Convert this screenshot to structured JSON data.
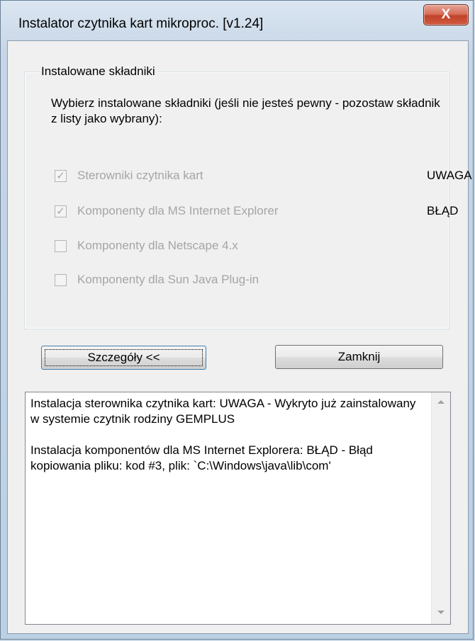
{
  "window": {
    "title": "Instalator czytnika kart mikroproc. [v1.24]",
    "close_glyph": "X"
  },
  "group": {
    "legend": "Instalowane składniki",
    "instruction": "Wybierz instalowane składniki (jeśli nie jesteś pewny - pozostaw składnik z listy jako wybrany):",
    "components": [
      {
        "label": "Sterowniki czytnika kart",
        "checked": true,
        "status": "UWAGA"
      },
      {
        "label": "Komponenty dla MS Internet Explorer",
        "checked": true,
        "status": "BŁĄD"
      },
      {
        "label": "Komponenty dla Netscape 4.x",
        "checked": false,
        "status": ""
      },
      {
        "label": "Komponenty dla Sun Java Plug-in",
        "checked": false,
        "status": ""
      }
    ]
  },
  "buttons": {
    "details_label": "Szczegóły <<",
    "close_label": "Zamknij"
  },
  "log": {
    "text": "Instalacja sterownika czytnika kart: UWAGA - Wykryto już zainstalowany w systemie czytnik rodziny GEMPLUS\n\nInstalacja komponentów dla MS Internet Explorera: BŁĄD - Błąd kopiowania pliku: kod #3, plik: `C:\\Windows\\java\\lib\\com'"
  }
}
